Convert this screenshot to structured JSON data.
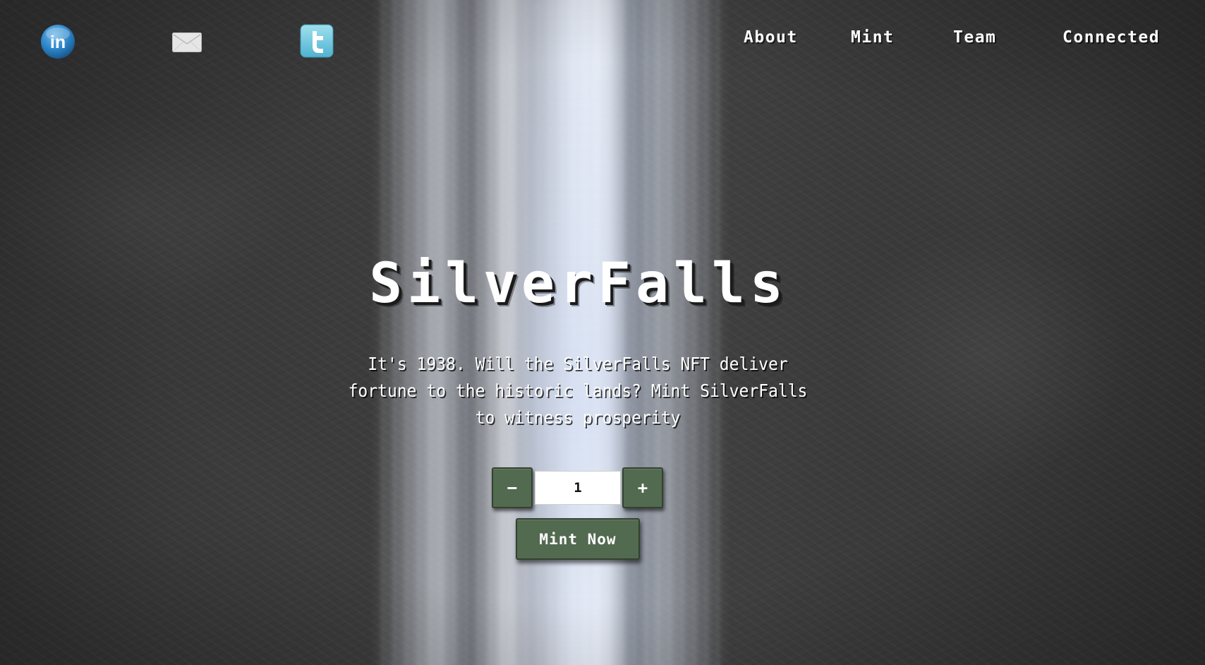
{
  "social": [
    {
      "name": "linkedin",
      "icon": "linkedin-icon",
      "glyph": "in",
      "color": "#2d86c8"
    },
    {
      "name": "email",
      "icon": "envelope-icon",
      "color": "#e6e6e6"
    },
    {
      "name": "twitter",
      "icon": "twitter-icon",
      "glyph": "t",
      "color": "#6fc6dc"
    }
  ],
  "nav": {
    "about": "About",
    "mint": "Mint",
    "team": "Team",
    "connected": "Connected"
  },
  "hero": {
    "title": "SilverFalls",
    "tagline": "It's 1938. Will the SilverFalls NFT deliver fortune to the historic lands? Mint SilverFalls to witness prosperity"
  },
  "mint": {
    "minus_label": "−",
    "plus_label": "+",
    "quantity": "1",
    "button_label": "Mint Now"
  },
  "colors": {
    "button_bg": "#526a50",
    "button_border": "#32422f",
    "text": "#ffffff"
  }
}
